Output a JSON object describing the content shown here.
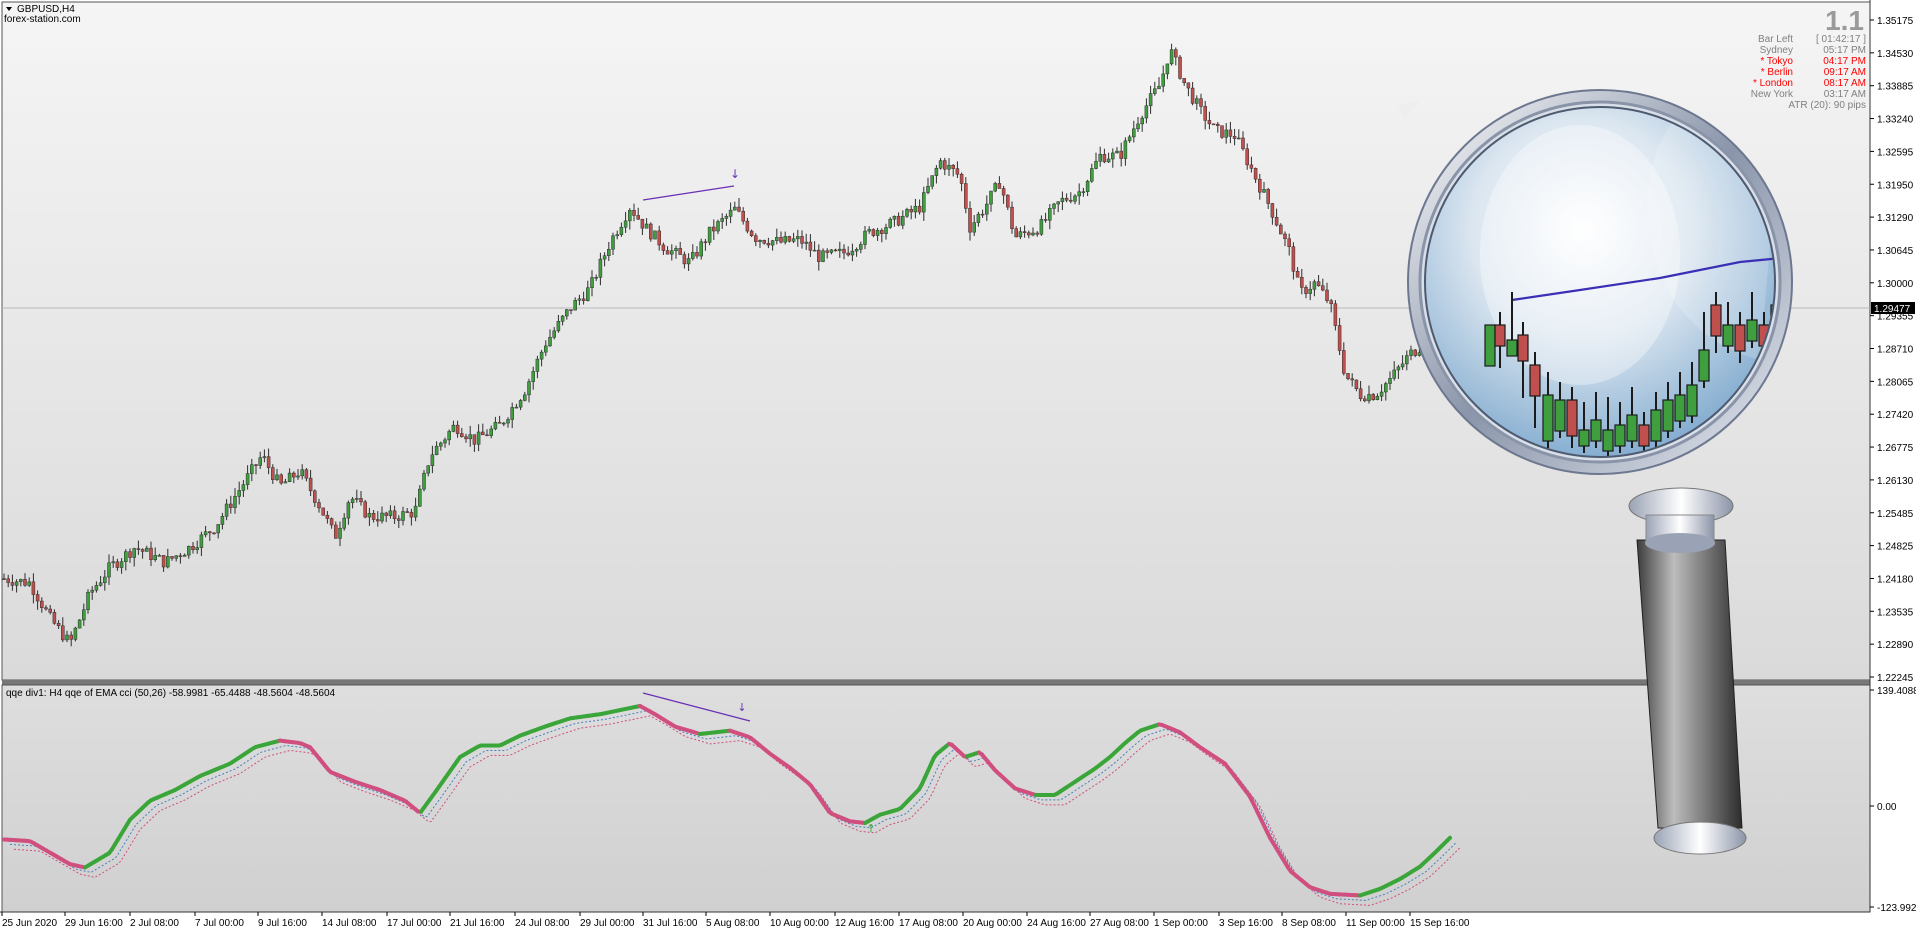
{
  "window": {
    "symbol_title": "GBPUSD,H4",
    "source": "forex-station.com",
    "version_big": "1.1"
  },
  "clock_panel": {
    "rows": [
      {
        "label": "Bar Left",
        "value": "[ 01:42:17 ]",
        "color": "#808080"
      },
      {
        "label": "Sydney",
        "value": "05:17 PM",
        "color": "#808080"
      },
      {
        "label": "* Tokyo",
        "value": "04:17 PM",
        "color": "#ff0000"
      },
      {
        "label": "* Berlin",
        "value": "09:17 AM",
        "color": "#ff0000"
      },
      {
        "label": "* London",
        "value": "08:17 AM",
        "color": "#ff0000"
      },
      {
        "label": "New York",
        "value": "03:17 AM",
        "color": "#808080"
      }
    ],
    "atr": "ATR (20): 90 pips"
  },
  "price_axis": {
    "ticks": [
      "1.35175",
      "1.34530",
      "1.33885",
      "1.33240",
      "1.32595",
      "1.31950",
      "1.31290",
      "1.30645",
      "1.30000",
      "1.29355",
      "1.28710",
      "1.28065",
      "1.27420",
      "1.26775",
      "1.26130",
      "1.25485",
      "1.24825",
      "1.24180",
      "1.23535",
      "1.22890",
      "1.22245"
    ],
    "current_price": "1.29477"
  },
  "indicator": {
    "label": "qqe div1: H4 qqe of EMA cci (50,26) -58.9981 -65.4488 -48.5604 -48.5604",
    "ticks": [
      "139.4088",
      "0.00",
      "-123.9921"
    ]
  },
  "time_axis": {
    "labels": [
      "25 Jun 2020",
      "29 Jun 16:00",
      "2 Jul 08:00",
      "7 Jul 00:00",
      "9 Jul 16:00",
      "14 Jul 08:00",
      "17 Jul 00:00",
      "21 Jul 16:00",
      "24 Jul 08:00",
      "29 Jul 00:00",
      "31 Jul 16:00",
      "5 Aug 08:00",
      "10 Aug 00:00",
      "12 Aug 16:00",
      "17 Aug 08:00",
      "20 Aug 00:00",
      "24 Aug 16:00",
      "27 Aug 08:00",
      "1 Sep 00:00",
      "3 Sep 16:00",
      "8 Sep 08:00",
      "11 Sep 00:00",
      "15 Sep 16:00"
    ]
  },
  "colors": {
    "bull_candle": "#3f9f3f",
    "bear_candle": "#c0504d",
    "qqe_up": "#3aa63a",
    "qqe_down": "#d04f7f",
    "div_line": "#6a2fb5",
    "panel_bg_top": "#f4f4f4",
    "panel_bg_bottom": "#d8d8d8"
  },
  "chart_data": {
    "type": "line",
    "title": "GBPUSD,H4",
    "series": [
      {
        "name": "GBPUSD,H4",
        "x": [
          "25 Jun 2020",
          "29 Jun 16:00",
          "2 Jul 08:00",
          "7 Jul 00:00",
          "9 Jul 16:00",
          "14 Jul 08:00",
          "17 Jul 00:00",
          "21 Jul 16:00",
          "24 Jul 08:00",
          "29 Jul 00:00",
          "31 Jul 16:00",
          "5 Aug 08:00",
          "10 Aug 00:00",
          "12 Aug 16:00",
          "17 Aug 08:00",
          "20 Aug 00:00",
          "24 Aug 16:00",
          "27 Aug 08:00",
          "1 Sep 00:00",
          "3 Sep 16:00",
          "8 Sep 08:00",
          "11 Sep 00:00",
          "15 Sep 16:00"
        ],
        "values": [
          1.2418,
          1.23,
          1.247,
          1.252,
          1.266,
          1.252,
          1.253,
          1.27,
          1.278,
          1.296,
          1.31,
          1.3135,
          1.307,
          1.306,
          1.318,
          1.311,
          1.308,
          1.325,
          1.344,
          1.33,
          1.288,
          1.278,
          1.295
        ]
      },
      {
        "name": "qqe div1",
        "x": [
          "25 Jun 2020",
          "29 Jun 16:00",
          "2 Jul 08:00",
          "7 Jul 00:00",
          "9 Jul 16:00",
          "14 Jul 08:00",
          "17 Jul 00:00",
          "21 Jul 16:00",
          "24 Jul 08:00",
          "29 Jul 00:00",
          "31 Jul 16:00",
          "5 Aug 08:00",
          "10 Aug 00:00",
          "12 Aug 16:00",
          "17 Aug 08:00",
          "20 Aug 00:00",
          "24 Aug 16:00",
          "27 Aug 08:00",
          "1 Sep 00:00",
          "3 Sep 16:00",
          "8 Sep 08:00",
          "11 Sep 00:00",
          "15 Sep 16:00"
        ],
        "values": [
          -60,
          -95,
          0,
          55,
          85,
          70,
          -5,
          85,
          108,
          118,
          125,
          90,
          60,
          -20,
          -5,
          80,
          30,
          90,
          110,
          75,
          -60,
          -115,
          -60
        ]
      }
    ],
    "ylim": [
      1.22245,
      1.35175
    ],
    "indicator_ylim": [
      -123.9921,
      139.4088
    ],
    "xlabel": "",
    "ylabel": ""
  }
}
